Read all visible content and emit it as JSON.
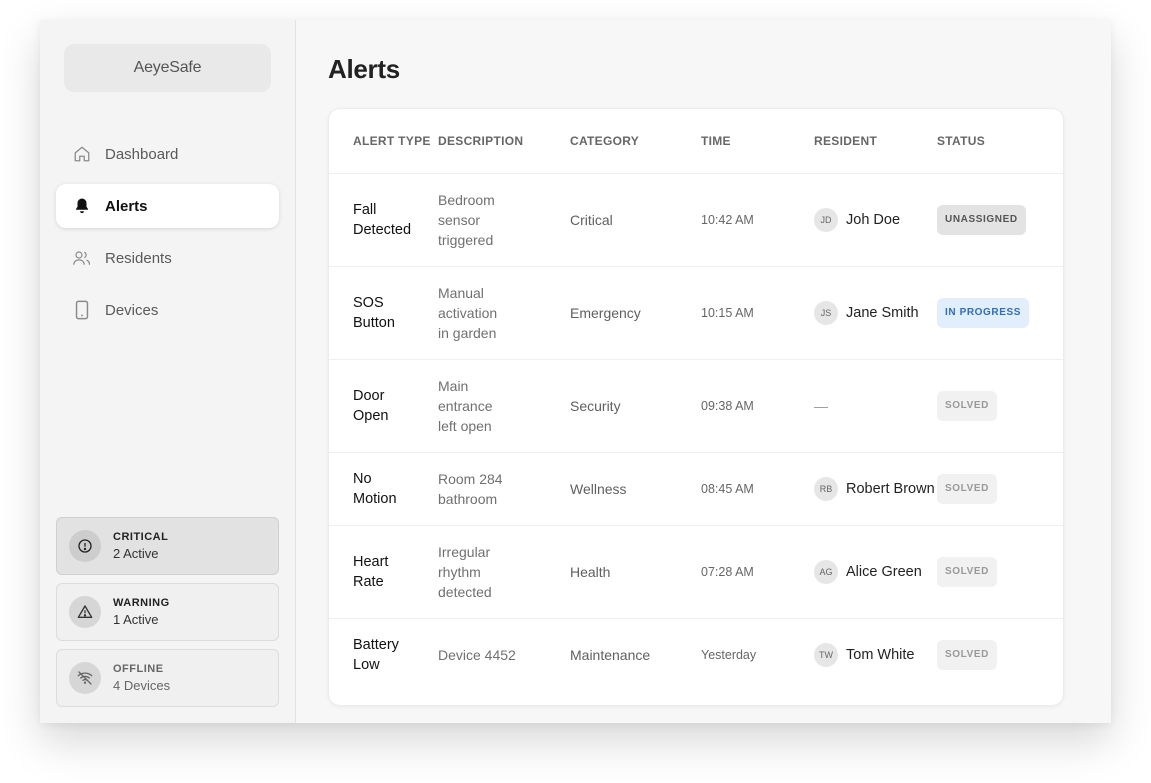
{
  "app": {
    "logo": "AeyeSafe"
  },
  "nav": [
    {
      "label": "Dashboard",
      "icon": "home-icon",
      "active": false
    },
    {
      "label": "Alerts",
      "icon": "bell-icon",
      "active": true
    },
    {
      "label": "Residents",
      "icon": "users-icon",
      "active": false
    },
    {
      "label": "Devices",
      "icon": "tablet-icon",
      "active": false
    }
  ],
  "status_cards": [
    {
      "title": "CRITICAL",
      "value": "2 Active",
      "icon": "alert-circle-icon"
    },
    {
      "title": "WARNING",
      "value": "1 Active",
      "icon": "warning-triangle-icon"
    },
    {
      "title": "OFFLINE",
      "value": "4 Devices",
      "icon": "wifi-off-icon"
    }
  ],
  "page": {
    "title": "Alerts"
  },
  "table": {
    "headers": [
      "ALERT TYPE",
      "DESCRIPTION",
      "CATEGORY",
      "TIME",
      "RESIDENT",
      "STATUS"
    ],
    "rows": [
      {
        "type_l1": "Fall",
        "type_l2": "Detected",
        "desc": [
          "Bedroom",
          "sensor",
          "triggered"
        ],
        "category": "Critical",
        "time": "10:42 AM",
        "initials": "JD",
        "resident": "Joh Doe",
        "status": "UNASSIGNED"
      },
      {
        "type_l1": "SOS",
        "type_l2": "Button",
        "desc": [
          "Manual",
          "activation",
          "in garden"
        ],
        "category": "Emergency",
        "time": "10:15 AM",
        "initials": "JS",
        "resident": "Jane Smith",
        "status": "IN PROGRESS"
      },
      {
        "type_l1": "Door",
        "type_l2": "Open",
        "desc": [
          "Main",
          "entrance",
          "left open"
        ],
        "category": "Security",
        "time": "09:38 AM",
        "initials": "",
        "resident": "—",
        "status": "SOLVED"
      },
      {
        "type_l1": "No",
        "type_l2": "Motion",
        "desc": [
          "Room 284",
          "bathroom"
        ],
        "category": "Wellness",
        "time": "08:45 AM",
        "initials": "RB",
        "resident": "Robert Brown",
        "status": "SOLVED"
      },
      {
        "type_l1": "Heart",
        "type_l2": "Rate",
        "desc": [
          "Irregular",
          "rhythm",
          "detected"
        ],
        "category": "Health",
        "time": "07:28 AM",
        "initials": "AG",
        "resident": "Alice Green",
        "status": "SOLVED"
      },
      {
        "type_l1": "Battery",
        "type_l2": "Low",
        "desc": [
          "Device 4452"
        ],
        "category": "Maintenance",
        "time": "Yesterday",
        "initials": "TW",
        "resident": "Tom White",
        "status": "SOLVED"
      }
    ]
  },
  "colors": {
    "in_progress_bg": "#e1eefc",
    "in_progress_text": "#2f6cc4",
    "unassigned_bg": "#e3e3e3"
  }
}
